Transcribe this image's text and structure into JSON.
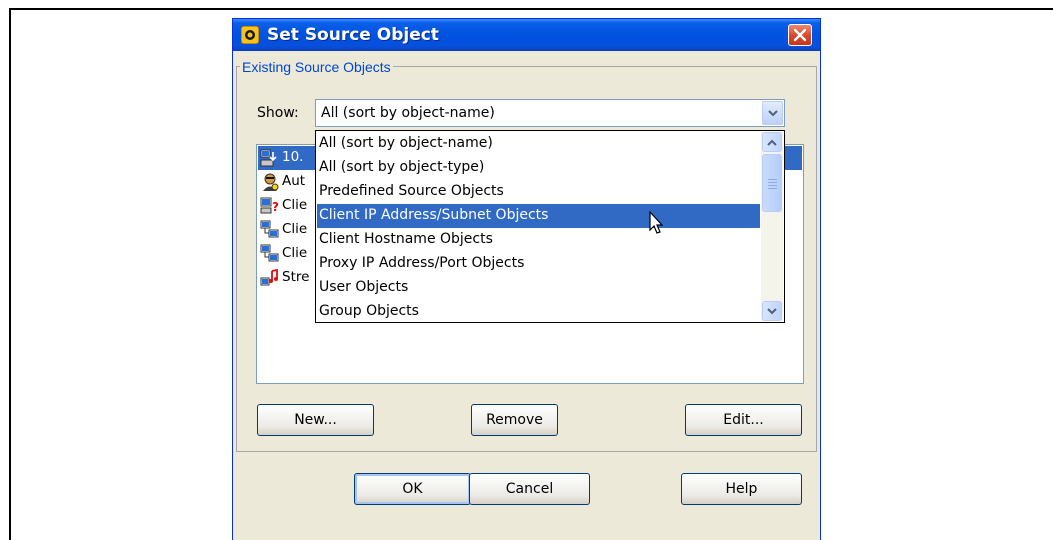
{
  "window": {
    "title": "Set Source Object"
  },
  "group": {
    "legend": "Existing Source Objects"
  },
  "show": {
    "label": "Show:",
    "selected": "All (sort by object-name)",
    "options": [
      "All (sort by object-name)",
      "All (sort by object-type)",
      "Predefined Source Objects",
      "Client IP Address/Subnet Objects",
      "Client Hostname Objects",
      "Proxy IP Address/Port Objects",
      "User Objects",
      "Group Objects"
    ],
    "highlighted_index": 3
  },
  "objects_list": {
    "items": [
      {
        "label": "10.",
        "icon": "network-transfer-icon",
        "selected": true
      },
      {
        "label": "Aut",
        "icon": "user-auth-icon"
      },
      {
        "label": "Clie",
        "icon": "client-unknown-icon"
      },
      {
        "label": "Clie",
        "icon": "client-network-icon"
      },
      {
        "label": "Clie",
        "icon": "client-network-icon"
      },
      {
        "label": "Stre",
        "icon": "stream-media-icon"
      }
    ]
  },
  "actions": {
    "new": "New...",
    "remove": "Remove",
    "edit": "Edit..."
  },
  "footer": {
    "ok": "OK",
    "cancel": "Cancel",
    "help": "Help"
  },
  "colors": {
    "titlebar": "#0052e0",
    "selection": "#316ac5",
    "legend": "#0046d5"
  }
}
